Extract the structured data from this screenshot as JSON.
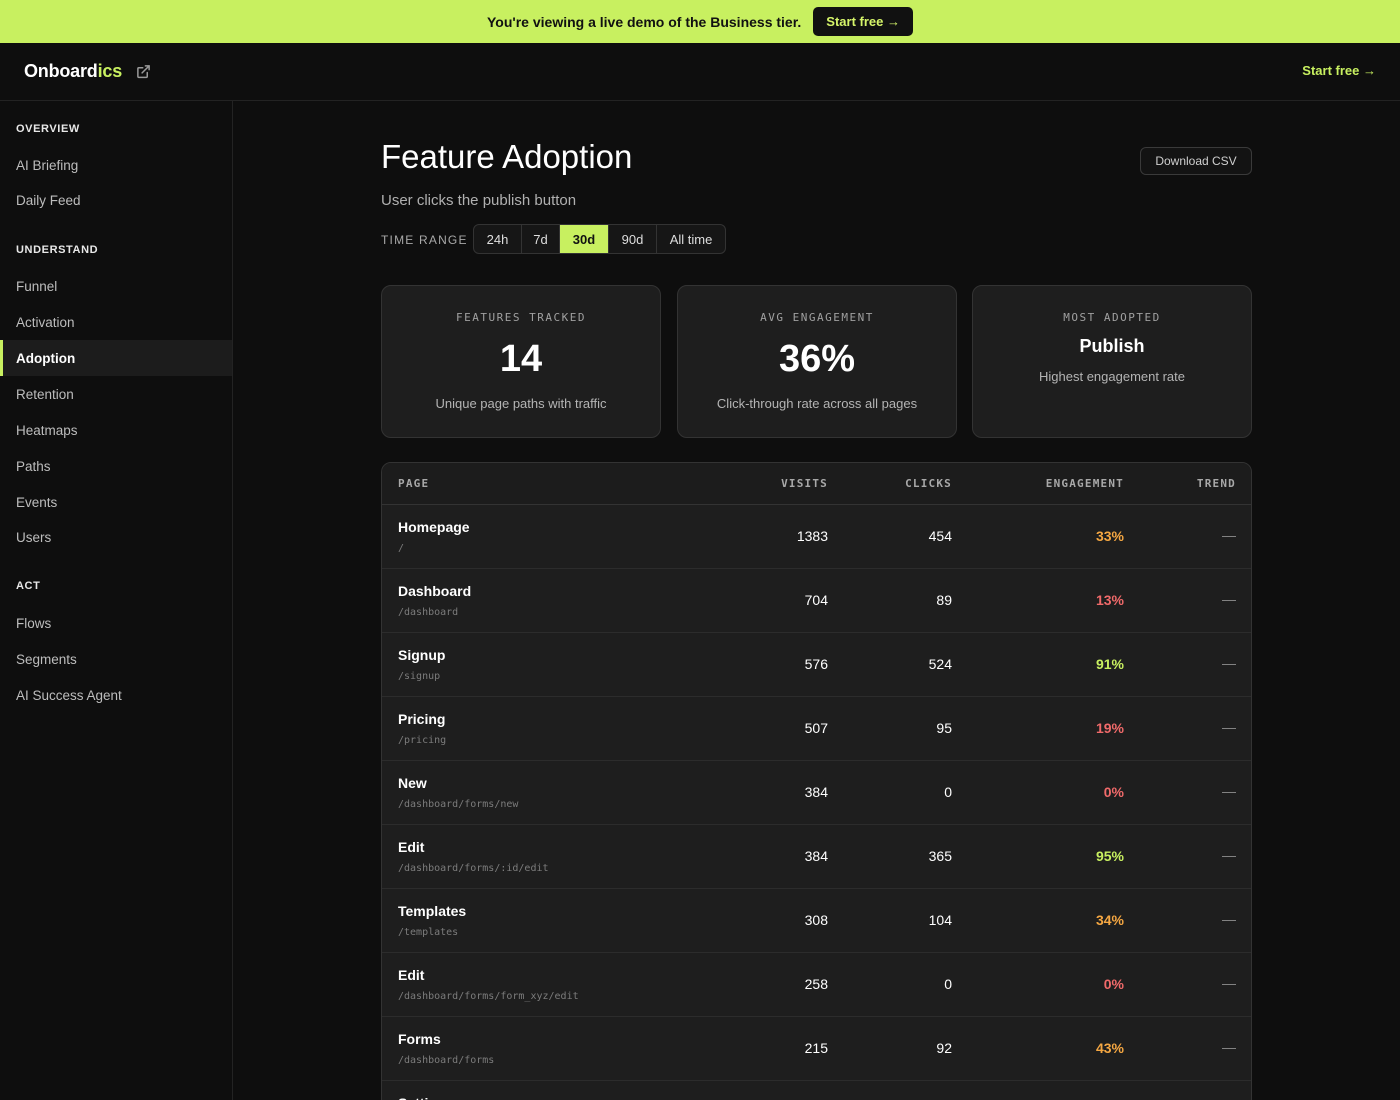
{
  "banner": {
    "text": "You're viewing a live demo of the Business tier.",
    "cta": "Start free →"
  },
  "topbar": {
    "logo_main": "Onboard",
    "logo_accent": "ics",
    "start_free": "Start free →"
  },
  "sidebar": {
    "groups": [
      {
        "title": "OVERVIEW",
        "items": [
          "AI Briefing",
          "Daily Feed"
        ]
      },
      {
        "title": "UNDERSTAND",
        "items": [
          "Funnel",
          "Activation",
          "Adoption",
          "Retention",
          "Heatmaps",
          "Paths",
          "Events",
          "Users"
        ]
      },
      {
        "title": "ACT",
        "items": [
          "Flows",
          "Segments",
          "AI Success Agent"
        ]
      }
    ],
    "active_item": "Adoption"
  },
  "page": {
    "title": "Feature Adoption",
    "subtitle": "User clicks the publish button",
    "download_label": "Download CSV",
    "time_range_label": "TIME RANGE",
    "time_ranges": [
      "24h",
      "7d",
      "30d",
      "90d",
      "All time"
    ],
    "selected_range": "30d"
  },
  "cards": [
    {
      "label": "FEATURES TRACKED",
      "value": "14",
      "desc": "Unique page paths with traffic"
    },
    {
      "label": "AVG ENGAGEMENT",
      "value": "36%",
      "desc": "Click-through rate across all pages"
    },
    {
      "label": "MOST ADOPTED",
      "value": "Publish",
      "desc": "Highest engagement rate"
    }
  ],
  "table": {
    "headers": {
      "page": "PAGE",
      "visits": "VISITS",
      "clicks": "CLICKS",
      "engagement": "ENGAGEMENT",
      "trend": "TREND"
    },
    "rows": [
      {
        "name": "Homepage",
        "path": "/",
        "visits": "1383",
        "clicks": "454",
        "engagement": "33%",
        "trend": "—",
        "level": "mid"
      },
      {
        "name": "Dashboard",
        "path": "/dashboard",
        "visits": "704",
        "clicks": "89",
        "engagement": "13%",
        "trend": "—",
        "level": "low"
      },
      {
        "name": "Signup",
        "path": "/signup",
        "visits": "576",
        "clicks": "524",
        "engagement": "91%",
        "trend": "—",
        "level": "high"
      },
      {
        "name": "Pricing",
        "path": "/pricing",
        "visits": "507",
        "clicks": "95",
        "engagement": "19%",
        "trend": "—",
        "level": "low"
      },
      {
        "name": "New",
        "path": "/dashboard/forms/new",
        "visits": "384",
        "clicks": "0",
        "engagement": "0%",
        "trend": "—",
        "level": "low"
      },
      {
        "name": "Edit",
        "path": "/dashboard/forms/:id/edit",
        "visits": "384",
        "clicks": "365",
        "engagement": "95%",
        "trend": "—",
        "level": "high"
      },
      {
        "name": "Templates",
        "path": "/templates",
        "visits": "308",
        "clicks": "104",
        "engagement": "34%",
        "trend": "—",
        "level": "mid"
      },
      {
        "name": "Edit",
        "path": "/dashboard/forms/form_xyz/edit",
        "visits": "258",
        "clicks": "0",
        "engagement": "0%",
        "trend": "—",
        "level": "low"
      },
      {
        "name": "Forms",
        "path": "/dashboard/forms",
        "visits": "215",
        "clicks": "92",
        "engagement": "43%",
        "trend": "—",
        "level": "mid"
      },
      {
        "name": "Settings",
        "path": "",
        "visits": "",
        "clicks": "",
        "engagement": "",
        "trend": "",
        "level": "mid"
      }
    ]
  },
  "colors": {
    "accent": "#c8f060",
    "low": "#f06a6a",
    "mid": "#f5a742",
    "high": "#c8f060"
  },
  "icons": {
    "external_link": "external-link-icon"
  }
}
